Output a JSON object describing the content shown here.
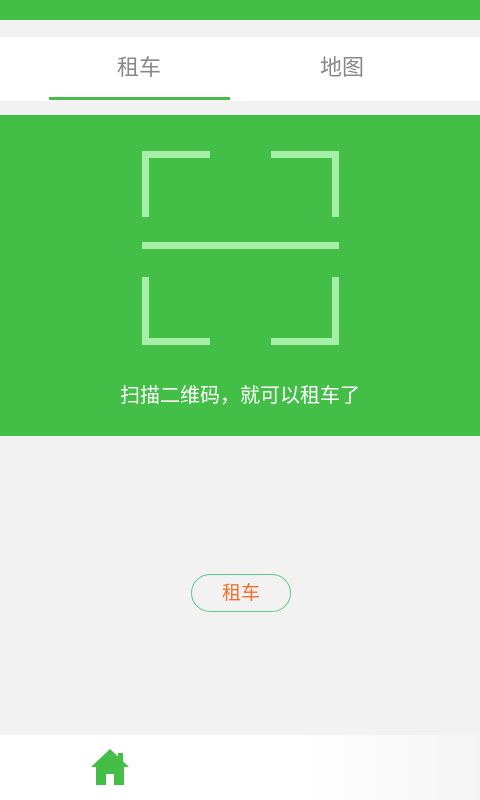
{
  "tabs": [
    {
      "label": "租车"
    },
    {
      "label": "地图"
    }
  ],
  "scan": {
    "hint": "扫描二维码，就可以租车了"
  },
  "action": {
    "rent_label": "租车"
  },
  "colors": {
    "brand": "#43bf48",
    "accent": "#f0712e",
    "frame": "#a5efa8"
  },
  "icons": {
    "home": "home-icon",
    "scan": "scan-frame-icon"
  }
}
